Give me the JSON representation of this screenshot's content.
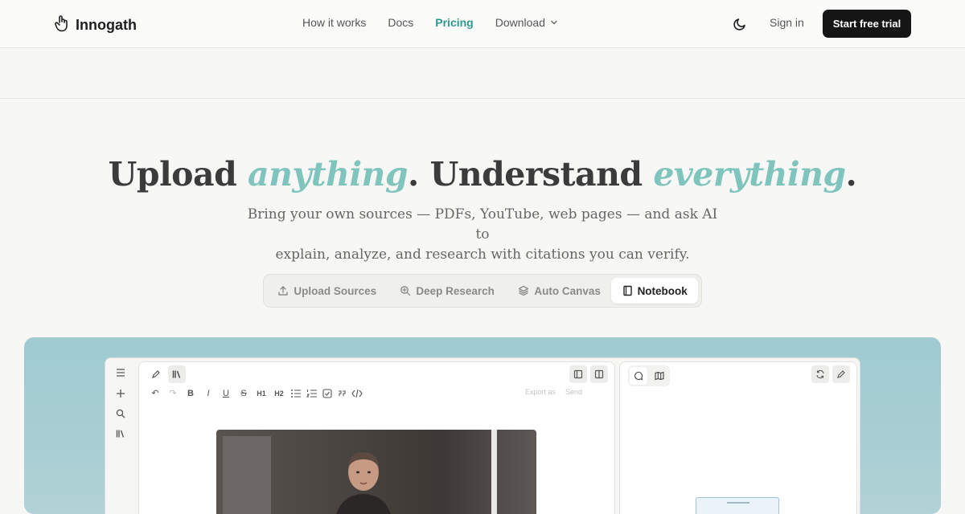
{
  "brand": {
    "name": "Innogath"
  },
  "nav": {
    "items": [
      {
        "label": "How it works"
      },
      {
        "label": "Docs"
      },
      {
        "label": "Pricing",
        "active": true
      },
      {
        "label": "Download",
        "has_dropdown": true
      }
    ],
    "sign_in": "Sign in",
    "cta": "Start free trial",
    "theme_icon": "moon-icon"
  },
  "hero": {
    "title_part1": "Upload ",
    "title_accent1": "anything",
    "title_part2": ". Understand ",
    "title_accent2": "everything",
    "title_part3": ".",
    "subtitle_line1": "Bring your own sources — PDFs, YouTube, web pages — and ask AI to",
    "subtitle_line2": "explain, analyze, and research with citations you can verify."
  },
  "tabs": [
    {
      "label": "Upload Sources",
      "icon": "upload-icon"
    },
    {
      "label": "Deep Research",
      "icon": "search-zoom-icon"
    },
    {
      "label": "Auto Canvas",
      "icon": "layers-icon"
    },
    {
      "label": "Notebook",
      "icon": "notebook-icon",
      "selected": true
    }
  ],
  "preview": {
    "formatting": [
      "↶",
      "↷",
      "B",
      "I",
      "U",
      "S",
      "H1",
      "H2"
    ],
    "export_label": "Export as",
    "send_label": "Send"
  },
  "colors": {
    "accent": "#2e9a8f",
    "accent_soft": "#7fc4bd",
    "cta_bg": "#151515",
    "preview_bg": "#9fcbd1"
  }
}
